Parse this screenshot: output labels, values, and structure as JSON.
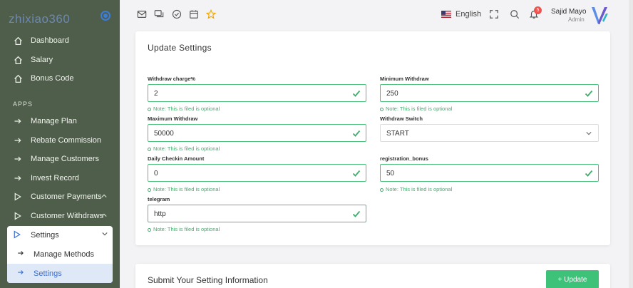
{
  "sidebar": {
    "brand": "zhixiao360",
    "items_top": [
      {
        "label": "Dashboard",
        "icon": "home-icon"
      },
      {
        "label": "Salary",
        "icon": "home-icon"
      },
      {
        "label": "Bonus Code",
        "icon": "home-icon"
      }
    ],
    "section_apps": "APPS",
    "items_apps": [
      {
        "label": "Manage Plan",
        "icon": "arrow-right-icon"
      },
      {
        "label": "Rebate Commission",
        "icon": "arrow-right-icon"
      },
      {
        "label": "Manage Customers",
        "icon": "arrow-right-icon"
      },
      {
        "label": "Invest Record",
        "icon": "arrow-right-icon"
      },
      {
        "label": "Customer Payments",
        "icon": "play-icon"
      },
      {
        "label": "Customer Withdraws",
        "icon": "play-icon"
      }
    ],
    "settings_menu": {
      "label": "Settings",
      "children": [
        {
          "label": "Manage Methods"
        },
        {
          "label": "Settings"
        }
      ]
    }
  },
  "header": {
    "language": "English",
    "notification_count": "5",
    "user_name": "Sajid Mayo",
    "user_role": "Admin"
  },
  "form": {
    "title": "Update Settings",
    "note": "Note: This is filed is optional",
    "fields": {
      "withdraw_charge": {
        "label": "Withdraw charge%",
        "value": "2"
      },
      "minimum_withdraw": {
        "label": "Minimum Withdraw",
        "value": "250"
      },
      "maximum_withdraw": {
        "label": "Maximum Withdraw",
        "value": "50000"
      },
      "withdraw_switch": {
        "label": "Withdraw Switch",
        "value": "START"
      },
      "daily_checkin": {
        "label": "Daily Checkin Amount",
        "value": "0"
      },
      "registration_bonus": {
        "label": "registration_bonus",
        "value": "50"
      },
      "telegram": {
        "label": "telegram",
        "value": "http"
      }
    }
  },
  "submit_section": {
    "title": "Submit Your Setting Information",
    "button": "+ Update"
  },
  "colors": {
    "sidebar_bg": "#4f5e4a",
    "accent": "#3b6fd1",
    "valid_green": "#4cc27f",
    "button_green": "#3ec27a"
  }
}
